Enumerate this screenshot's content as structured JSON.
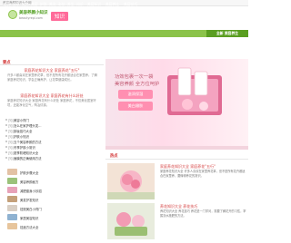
{
  "topbar": {
    "text": "美容养颜知识大全网"
  },
  "header": {
    "logo_text": "美容养颜小知识",
    "logo_sub": "beautyrepl.com",
    "badge": "知识"
  },
  "nav": {
    "items": [
      "首页",
      "分享",
      "保养",
      "美容",
      "护肤",
      "美发",
      "彩妆",
      "养生",
      "知识",
      "美容知识",
      "美容养生",
      "美容技巧"
    ],
    "promo": "全新 美容养生"
  },
  "left": {
    "section_title": "要点",
    "headline1": "家庭养花知识大全 家庭养花\"五行\"",
    "summary1": "许多人都喜欢在家里养花草，但不是所有花卉都适合在家里养。了解家庭养花知识，学会正确养护，让花草健康成长。",
    "headline2": "家庭养花知识大全 家庭养花有什么好处",
    "summary2": "家庭养花知识大全 家庭养花有什么好处 家庭养花，不仅美化居室环境，还能净化空气，陶冶情操。",
    "list": [
      {
        "tag": "[知]",
        "text": "美容小窍门"
      },
      {
        "tag": "[知]",
        "text": "怎么在家护理头发…"
      },
      {
        "tag": "[知]",
        "text": "卸妆技巧大全"
      },
      {
        "tag": "[知]",
        "text": "护肤小知识"
      },
      {
        "tag": "[知]",
        "text": "五个美容养颜的方法"
      },
      {
        "tag": "[知]",
        "text": "冬季护肤小常识"
      },
      {
        "tag": "[知]",
        "text": "夏季防晒知识大全"
      },
      {
        "tag": "[知]",
        "text": "面膜的正确使用方法"
      }
    ],
    "thumbs": [
      {
        "text": "护肤步骤大全",
        "color": "#e3c2a5"
      },
      {
        "text": "美容养颜秘方",
        "color": "#9bc27a"
      },
      {
        "text": "减肥瘦身小妙招",
        "color": "#e7a2b8"
      },
      {
        "text": "美发护发知识",
        "color": "#c4a07a"
      },
      {
        "text": "祛斑美白小窍门",
        "color": "#d9cfc4"
      },
      {
        "text": "家居美容知识",
        "color": "#8fb2d1"
      },
      {
        "text": "祛痘方法大全",
        "color": "#e7c59c"
      }
    ]
  },
  "banner": {
    "heading1": "功效包裹一次一袋",
    "heading2": "美容养颜 全方位呵护",
    "button1": "滋润保湿",
    "button2": "美白嫩肤",
    "accent": "#ff8fb1"
  },
  "hot": {
    "section_title": "热点",
    "cards": [
      {
        "title": "家庭养花知识大全 家庭养花\"五行\"",
        "body": "家庭养花知识大全 许多人喜欢在家里养花草，但不是所有花卉都适合在家里养，要懂得养花的常识。"
      },
      {
        "title": "养花知识大全 养花技巧",
        "body": "养花知识大全 养花技巧 养花是一门学问，需要了解花卉的习性，掌握浇水施肥的方法。"
      }
    ]
  }
}
